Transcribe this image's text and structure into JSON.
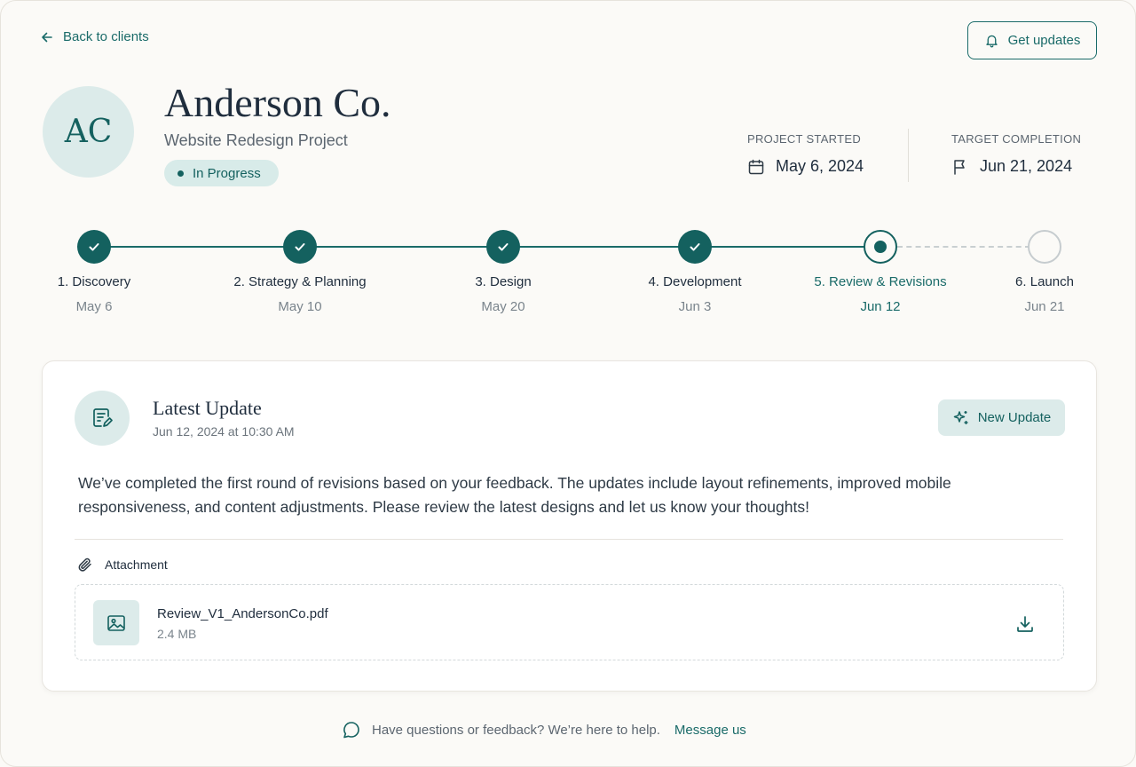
{
  "nav": {
    "back_label": "Back to clients",
    "get_updates_label": "Get updates"
  },
  "client": {
    "initials": "AC",
    "name": "Anderson Co.",
    "project": "Website Redesign Project",
    "status": "In Progress"
  },
  "meta": {
    "started_label": "PROJECT STARTED",
    "started_value": "May 6, 2024",
    "target_label": "TARGET COMPLETION",
    "target_value": "Jun 21, 2024"
  },
  "timeline": {
    "steps": [
      {
        "label": "1. Discovery",
        "date": "May 6",
        "state": "done"
      },
      {
        "label": "2. Strategy & Planning",
        "date": "May 10",
        "state": "done"
      },
      {
        "label": "3. Design",
        "date": "May 20",
        "state": "done"
      },
      {
        "label": "4. Development",
        "date": "Jun 3",
        "state": "done"
      },
      {
        "label": "5. Review & Revisions",
        "date": "Jun 12",
        "state": "current"
      },
      {
        "label": "6. Launch",
        "date": "Jun 21",
        "state": "pending"
      }
    ]
  },
  "update": {
    "title": "Latest Update",
    "timestamp": "Jun 12, 2024 at 10:30 AM",
    "new_update_label": "New Update",
    "body": "We’ve completed the first round of revisions based on your feedback. The updates include layout refinements, improved mobile responsiveness, and content adjustments. Please review the latest designs and let us know your thoughts!",
    "attachment_label": "Attachment",
    "file_name": "Review_V1_AndersonCo.pdf",
    "file_size": "2.4 MB"
  },
  "footer": {
    "text": "Have questions or feedback? We’re here to help.",
    "link_label": "Message us"
  },
  "colors": {
    "accent": "#14615f",
    "accent_light": "#dcebea",
    "background": "#fbfaf7"
  }
}
